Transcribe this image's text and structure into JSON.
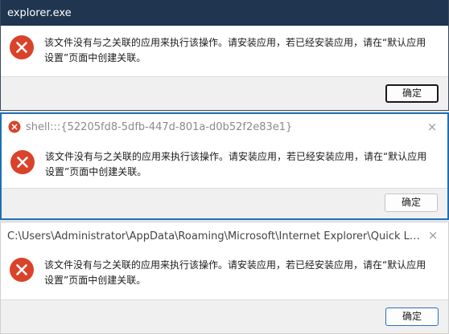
{
  "dialogs": [
    {
      "title": "explorer.exe",
      "message": "该文件没有与之关联的应用来执行该操作。请安装应用，若已经安装应用，请在“默认应用设置”页面中创建关联。",
      "ok_label": "确定",
      "close_icon": "×"
    },
    {
      "title": "shell:::{52205fd8-5dfb-447d-801a-d0b52f2e83e1}",
      "message": "该文件没有与之关联的应用来执行该操作。请安装应用，若已经安装应用，请在“默认应用设置”页面中创建关联。",
      "ok_label": "确定",
      "close_icon": "×"
    },
    {
      "title": "C:\\Users\\Administrator\\AppData\\Roaming\\Microsoft\\Internet Explorer\\Quick Launch\\User Pinned\\TaskBar",
      "message": "该文件没有与之关联的应用来执行该操作。请安装应用，若已经安装应用，请在“默认应用设置”页面中创建关联。",
      "ok_label": "确定",
      "close_icon": "×"
    }
  ],
  "colors": {
    "error_red": "#d9432a",
    "active_titlebar": "#1f3550",
    "focus_border": "#1f6fb5"
  },
  "icons": {
    "error": "error-icon",
    "close": "close-icon"
  }
}
